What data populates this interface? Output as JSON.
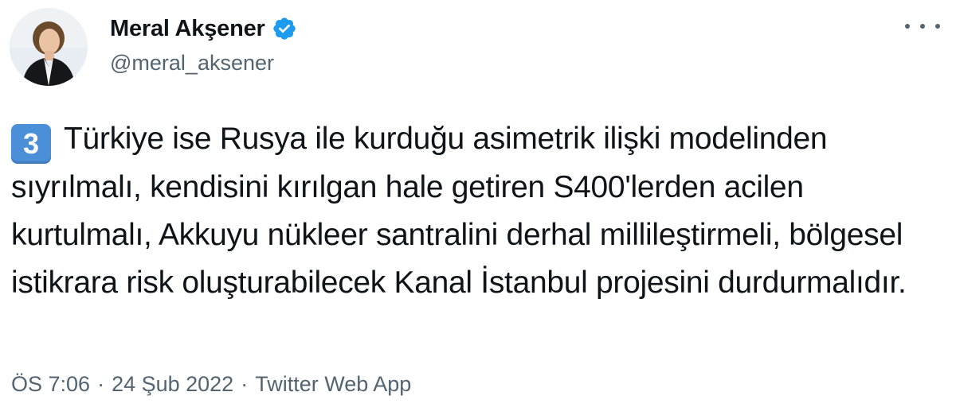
{
  "author": {
    "name": "Meral Akşener",
    "handle": "@meral_aksener",
    "verified": true,
    "avatar_icon": "profile-photo"
  },
  "tweet": {
    "keycap": "3",
    "text": "Türkiye ise Rusya ile kurduğu asimetrik ilişki modelinden sıyrılmalı, kendisini kırılgan hale getiren S400'lerden acilen kurtulmalı, Akkuyu nükleer santralini derhal millileştirmeli, bölgesel istikrara risk oluşturabilecek Kanal İstanbul projesini durdurmalıdır."
  },
  "meta": {
    "time": "ÖS 7:06",
    "separator": "·",
    "date": "24 Şub 2022",
    "source": "Twitter Web App"
  },
  "colors": {
    "text": "#0f1419",
    "secondary": "#536471",
    "verified": "#1d9bf0",
    "keycap": "#4b8fd9"
  },
  "icons": {
    "more": "more-horizontal-icon",
    "verified": "verified-badge-icon"
  }
}
